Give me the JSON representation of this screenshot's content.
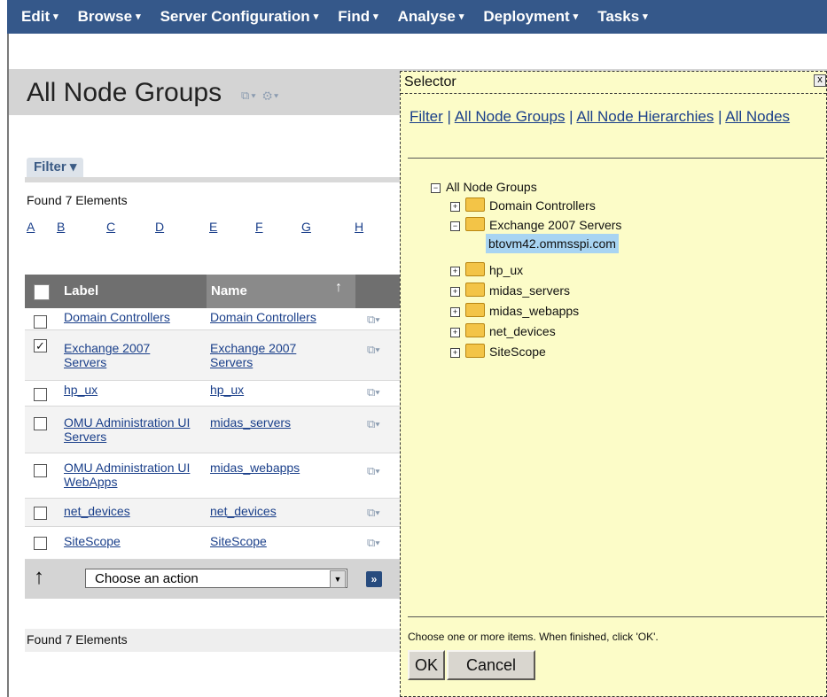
{
  "menu": {
    "items": [
      "Edit",
      "Browse",
      "Server Configuration",
      "Find",
      "Analyse",
      "Deployment",
      "Tasks"
    ],
    "caret": "▾"
  },
  "page": {
    "title": "All Node Groups",
    "title_icons": "⧉▾ ⚙▾"
  },
  "filter": {
    "tab": "Filter ▾"
  },
  "found_top": "Found 7 Elements",
  "alphabet": [
    "A",
    "B",
    "C",
    "D",
    "E",
    "F",
    "G",
    "H"
  ],
  "table": {
    "headers": {
      "label": "Label",
      "name": "Name",
      "sort_arrow": "↑"
    },
    "rows": [
      {
        "label": "Domain Controllers",
        "name": "Domain Controllers",
        "checked": false,
        "check": ""
      },
      {
        "label": "Exchange 2007 Servers",
        "name": "Exchange 2007 Servers",
        "checked": true,
        "check": "✓"
      },
      {
        "label": "hp_ux",
        "name": "hp_ux",
        "checked": false,
        "check": ""
      },
      {
        "label": "OMU Administration UI Servers",
        "name": "midas_servers",
        "checked": false,
        "check": ""
      },
      {
        "label": "OMU Administration UI WebApps",
        "name": "midas_webapps",
        "checked": false,
        "check": ""
      },
      {
        "label": "net_devices",
        "name": "net_devices",
        "checked": false,
        "check": ""
      },
      {
        "label": "SiteScope",
        "name": "SiteScope",
        "checked": false,
        "check": ""
      }
    ],
    "row_icon": "⧉▾"
  },
  "action": {
    "select_value": "Choose an action",
    "go": "»",
    "up_arrow": "↑"
  },
  "found_bottom": "Found 7 Elements",
  "selector": {
    "title": "Selector",
    "close": "x",
    "links": {
      "filter": "Filter",
      "sep": " | ",
      "all_groups": "All Node Groups",
      "all_hierarchies": "All Node Hierarchies",
      "all_nodes": "All Nodes"
    },
    "tree": {
      "root": "All Node Groups",
      "root_toggle": "−",
      "children": [
        {
          "label": "Domain Controllers",
          "toggle": "+"
        },
        {
          "label": "Exchange 2007 Servers",
          "toggle": "−",
          "expanded": true
        },
        {
          "label": "hp_ux",
          "toggle": "+"
        },
        {
          "label": "midas_servers",
          "toggle": "+"
        },
        {
          "label": "midas_webapps",
          "toggle": "+"
        },
        {
          "label": "net_devices",
          "toggle": "+"
        },
        {
          "label": "SiteScope",
          "toggle": "+"
        }
      ],
      "expanded_leaf": "btovm42.ommsspi.com"
    },
    "hint": "Choose one or more items. When finished, click 'OK'.",
    "ok": "OK",
    "cancel": "Cancel"
  }
}
